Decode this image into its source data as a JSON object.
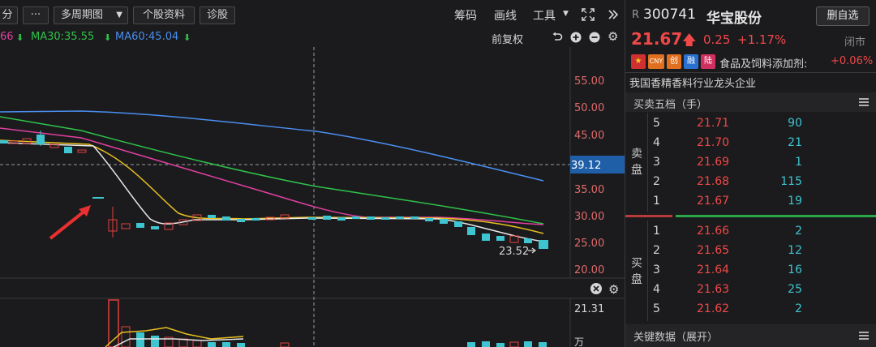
{
  "toolbar": {
    "period_prev": "分",
    "more": "···",
    "multi_period": "多周期图",
    "profile": "个股资料",
    "diagnose": "诊股",
    "chips": "筹码",
    "draw_line": "画线",
    "tools": "工具"
  },
  "ma": {
    "ma_prev": "66",
    "ma30": "MA30:35.55",
    "ma60": "MA60:45.04",
    "pre_adjust": "前复权",
    "colors": {
      "ma10": "#e8c020",
      "ma30": "#2ec24a",
      "ma60": "#4a8ef0",
      "ma20": "#e040a0",
      "ma5": "#e0e0e0"
    }
  },
  "chart": {
    "y_labels": [
      "55.00",
      "50.00",
      "45.00",
      "39.12",
      "35.00",
      "30.00",
      "25.00",
      "20.00"
    ],
    "crosshair_value": "39.12",
    "low_marker": "23.52",
    "volume_label": "21.31",
    "volume_unit": "万"
  },
  "stock": {
    "badge": "R",
    "code": "300741",
    "name": "华宝股份",
    "watchlist_btn": "删自选",
    "price": "21.67",
    "change": "0.25",
    "change_pct": "+1.17%",
    "status": "闭市",
    "tags": [
      "CNY",
      "创",
      "融",
      "陆"
    ],
    "industry": "食品及饲料添加剂:",
    "industry_pct": "+0.06%",
    "description": "我国香精香料行业龙头企业"
  },
  "orderbook": {
    "title": "买卖五档（手）",
    "sell_label": [
      "卖",
      "盘"
    ],
    "buy_label": [
      "买",
      "盘"
    ],
    "sell": [
      {
        "level": "5",
        "price": "21.71",
        "volume": "90"
      },
      {
        "level": "4",
        "price": "21.70",
        "volume": "21"
      },
      {
        "level": "3",
        "price": "21.69",
        "volume": "1"
      },
      {
        "level": "2",
        "price": "21.68",
        "volume": "115"
      },
      {
        "level": "1",
        "price": "21.67",
        "volume": "19"
      }
    ],
    "buy": [
      {
        "level": "1",
        "price": "21.66",
        "volume": "2"
      },
      {
        "level": "2",
        "price": "21.65",
        "volume": "12"
      },
      {
        "level": "3",
        "price": "21.64",
        "volume": "16"
      },
      {
        "level": "4",
        "price": "21.63",
        "volume": "25"
      },
      {
        "level": "5",
        "price": "21.62",
        "volume": "2"
      }
    ]
  },
  "key_data": {
    "title": "关键数据（展开）"
  }
}
